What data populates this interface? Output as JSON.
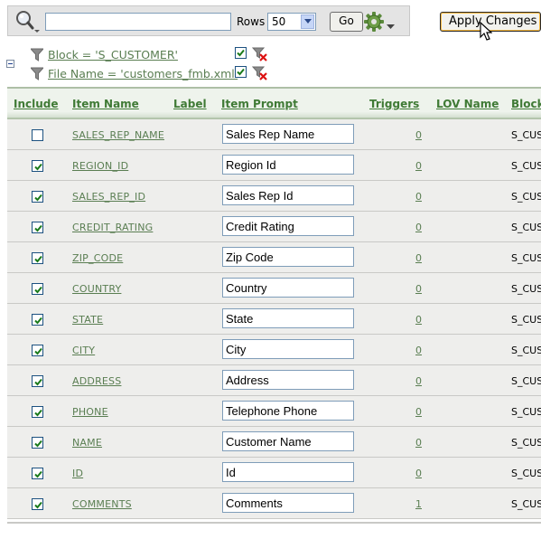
{
  "toolbar": {
    "search_value": "",
    "rows_label": "Rows",
    "rows_selected": "50",
    "go_label": "Go",
    "apply_label": "Apply Changes"
  },
  "filters": [
    {
      "text": "Block = 'S_CUSTOMER'",
      "enabled": true
    },
    {
      "text": "File Name = 'customers_fmb.xml'",
      "enabled": true
    }
  ],
  "table": {
    "columns": [
      "Include",
      "Item Name",
      "Label",
      "Item Prompt",
      "Triggers",
      "LOV Name",
      "Block"
    ],
    "rows": [
      {
        "include": false,
        "item_name": "SALES_REP_NAME",
        "label": "",
        "prompt": "Sales Rep Name",
        "triggers": "0",
        "lov": "",
        "block": "S_CUS"
      },
      {
        "include": true,
        "item_name": "REGION_ID",
        "label": "",
        "prompt": "Region Id",
        "triggers": "0",
        "lov": "",
        "block": "S_CUS"
      },
      {
        "include": true,
        "item_name": "SALES_REP_ID",
        "label": "",
        "prompt": "Sales Rep Id",
        "triggers": "0",
        "lov": "",
        "block": "S_CUS"
      },
      {
        "include": true,
        "item_name": "CREDIT_RATING",
        "label": "",
        "prompt": "Credit Rating",
        "triggers": "0",
        "lov": "",
        "block": "S_CUS"
      },
      {
        "include": true,
        "item_name": "ZIP_CODE",
        "label": "",
        "prompt": "Zip Code",
        "triggers": "0",
        "lov": "",
        "block": "S_CUS"
      },
      {
        "include": true,
        "item_name": "COUNTRY",
        "label": "",
        "prompt": "Country",
        "triggers": "0",
        "lov": "",
        "block": "S_CUS"
      },
      {
        "include": true,
        "item_name": "STATE",
        "label": "",
        "prompt": "State",
        "triggers": "0",
        "lov": "",
        "block": "S_CUS"
      },
      {
        "include": true,
        "item_name": "CITY",
        "label": "",
        "prompt": "City",
        "triggers": "0",
        "lov": "",
        "block": "S_CUS"
      },
      {
        "include": true,
        "item_name": "ADDRESS",
        "label": "",
        "prompt": "Address",
        "triggers": "0",
        "lov": "",
        "block": "S_CUS"
      },
      {
        "include": true,
        "item_name": "PHONE",
        "label": "",
        "prompt": "Telephone Phone",
        "triggers": "0",
        "lov": "",
        "block": "S_CUS"
      },
      {
        "include": true,
        "item_name": "NAME",
        "label": "",
        "prompt": "Customer Name",
        "triggers": "0",
        "lov": "",
        "block": "S_CUS"
      },
      {
        "include": true,
        "item_name": "ID",
        "label": "",
        "prompt": "Id",
        "triggers": "0",
        "lov": "",
        "block": "S_CUS"
      },
      {
        "include": true,
        "item_name": "COMMENTS",
        "label": "",
        "prompt": "Comments",
        "triggers": "1",
        "lov": "",
        "block": "S_CUS"
      }
    ]
  },
  "icons": {
    "search": "search-icon",
    "gear": "gear-icon",
    "filter": "funnel-icon",
    "remove_filter": "remove-filter-icon",
    "collapse": "collapse-icon",
    "cursor": "mouse-cursor-icon"
  },
  "colors": {
    "header_text": "#3f7a35",
    "link_text": "#5a7e52",
    "row_bg": "#eeeeec",
    "apply_highlight": "#f5b840"
  }
}
